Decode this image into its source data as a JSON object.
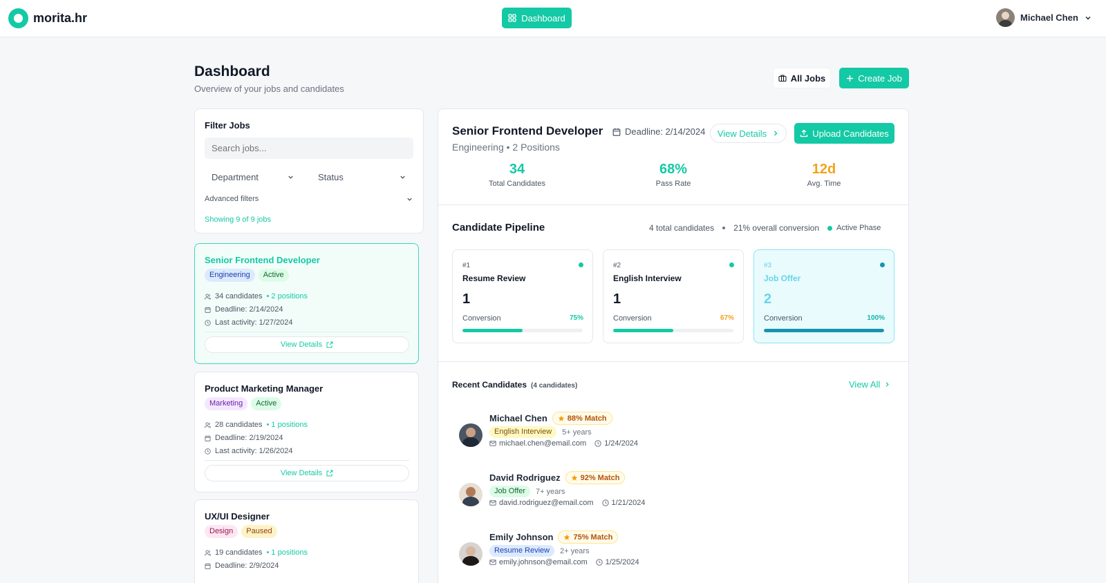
{
  "app": {
    "name": "morita.hr"
  },
  "nav": {
    "dashboard_label": "Dashboard"
  },
  "user": {
    "name": "Michael Chen"
  },
  "header": {
    "title": "Dashboard",
    "subtitle": "Overview of your jobs and candidates",
    "all_jobs_label": "All Jobs",
    "create_job_label": "Create Job"
  },
  "filter": {
    "title": "Filter Jobs",
    "search_placeholder": "Search jobs...",
    "department_label": "Department",
    "status_label": "Status",
    "advanced_label": "Advanced filters",
    "showing_text": "Showing 9 of 9 jobs"
  },
  "jobs": [
    {
      "title": "Senior Frontend Developer",
      "department": "Engineering",
      "status": "Active",
      "candidates": "34 candidates",
      "positions": "• 2 positions",
      "deadline": "Deadline: 2/14/2024",
      "last_activity": "Last activity: 1/27/2024",
      "view_label": "View Details"
    },
    {
      "title": "Product Marketing Manager",
      "department": "Marketing",
      "status": "Active",
      "candidates": "28 candidates",
      "positions": "• 1 positions",
      "deadline": "Deadline: 2/19/2024",
      "last_activity": "Last activity: 1/26/2024",
      "view_label": "View Details"
    },
    {
      "title": "UX/UI Designer",
      "department": "Design",
      "status": "Paused",
      "candidates": "19 candidates",
      "positions": "• 1 positions",
      "deadline": "Deadline: 2/9/2024"
    }
  ],
  "job_detail": {
    "title": "Senior Frontend Developer",
    "subtitle": "Engineering • 2 Positions",
    "deadline": "Deadline: 2/14/2024",
    "view_details_label": "View Details",
    "upload_label": "Upload Candidates",
    "stats": [
      {
        "value": "34",
        "label": "Total Candidates",
        "color": "#14c9a5"
      },
      {
        "value": "68%",
        "label": "Pass Rate",
        "color": "#14c9a5"
      },
      {
        "value": "12d",
        "label": "Avg. Time",
        "color": "#f2a31b"
      }
    ]
  },
  "pipeline": {
    "title": "Candidate Pipeline",
    "total_text": "4 total candidates",
    "conversion_text": "21% overall conversion",
    "active_phase_label": "Active Phase",
    "stages": [
      {
        "num": "#1",
        "name": "Resume Review",
        "count": "1",
        "conversion_label": "Conversion",
        "pct": "75%",
        "progress": 0.5,
        "pct_color": "#14c9a5"
      },
      {
        "num": "#2",
        "name": "English Interview",
        "count": "1",
        "conversion_label": "Conversion",
        "pct": "67%",
        "progress": 0.5,
        "pct_color": "#f2a31b"
      },
      {
        "num": "#3",
        "name": "Job Offer",
        "count": "2",
        "conversion_label": "Conversion",
        "pct": "100%",
        "progress": 1.0,
        "pct_color": "#14b8a6"
      }
    ]
  },
  "recent": {
    "title": "Recent Candidates",
    "count_text": "(4 candidates)",
    "view_all_label": "View All",
    "candidates": [
      {
        "name": "Michael Chen",
        "match": "88% Match",
        "stage": "English Interview",
        "experience": "5+ years",
        "email": "michael.chen@email.com",
        "date": "1/24/2024"
      },
      {
        "name": "David Rodriguez",
        "match": "92% Match",
        "stage": "Job Offer",
        "experience": "7+ years",
        "email": "david.rodriguez@email.com",
        "date": "1/21/2024"
      },
      {
        "name": "Emily Johnson",
        "match": "75% Match",
        "stage": "Resume Review",
        "experience": "2+ years",
        "email": "emily.johnson@email.com",
        "date": "1/25/2024"
      }
    ]
  },
  "colors": {
    "accent": "#14c9a5",
    "warning": "#f2a31b",
    "active_stage": "#1594b0"
  }
}
